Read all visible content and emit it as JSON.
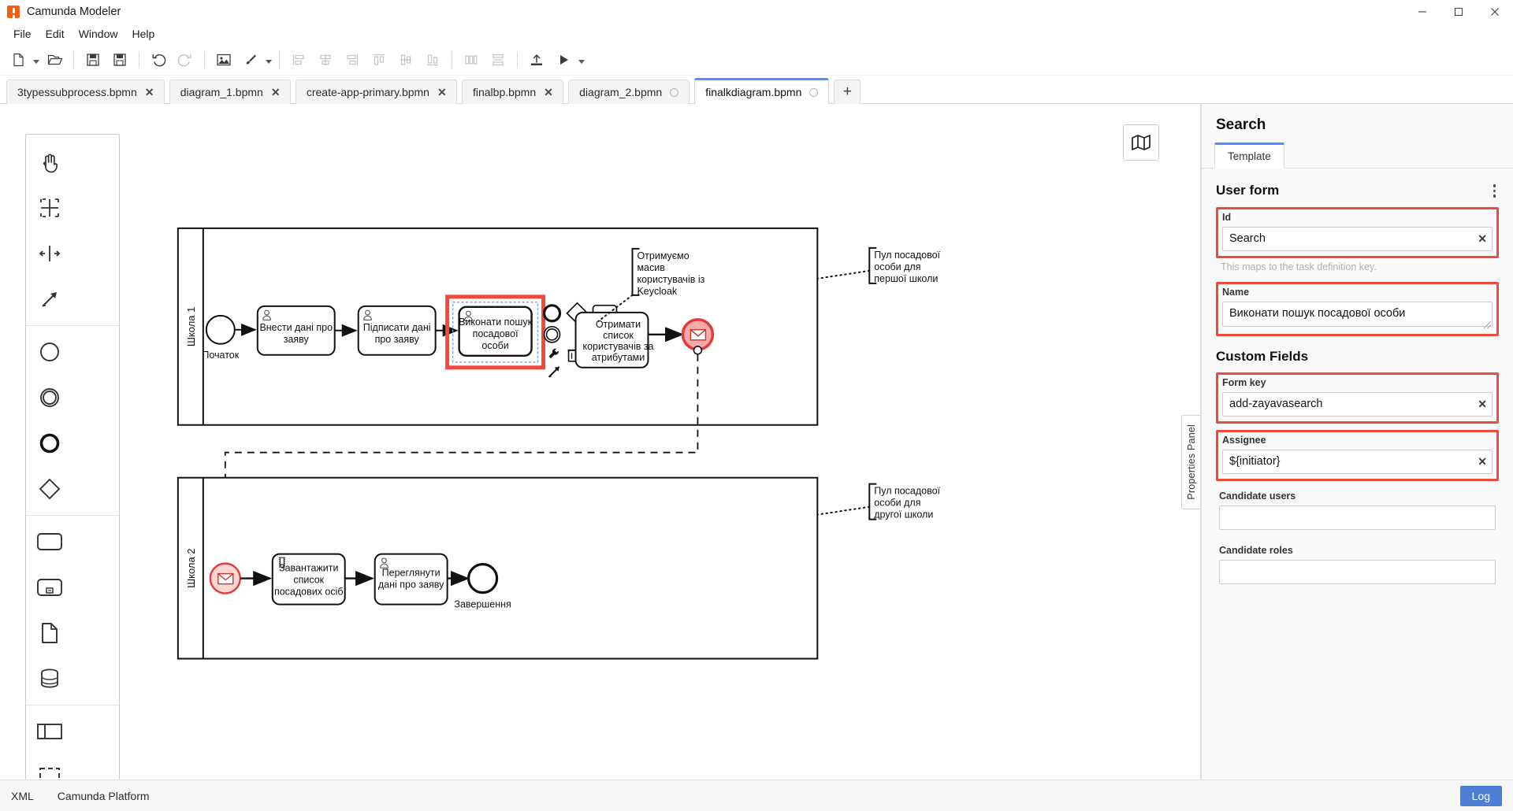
{
  "window": {
    "title": "Camunda Modeler",
    "app_icon": "camunda-icon",
    "minimize": "─",
    "maximize": "❐",
    "close": "✕"
  },
  "menubar": {
    "items": [
      {
        "label": "File"
      },
      {
        "label": "Edit"
      },
      {
        "label": "Window"
      },
      {
        "label": "Help"
      }
    ]
  },
  "toolbar": {
    "buttons": [
      {
        "name": "new-file-button",
        "icon": "new-file-icon"
      },
      {
        "name": "new-file-dropdown",
        "icon": "caret-down-icon"
      },
      {
        "name": "open-file-button",
        "icon": "open-folder-icon"
      },
      {
        "name": "save-button",
        "icon": "save-icon"
      },
      {
        "name": "save-as-button",
        "icon": "save-as-icon"
      },
      {
        "name": "undo-button",
        "icon": "undo-icon"
      },
      {
        "name": "redo-button",
        "icon": "redo-icon"
      },
      {
        "name": "export-image-button",
        "icon": "image-icon"
      },
      {
        "name": "align-tool-button",
        "icon": "brush-icon"
      },
      {
        "name": "align-tool-dropdown",
        "icon": "caret-down-icon"
      },
      {
        "name": "align-left-button",
        "icon": "align-left-icon"
      },
      {
        "name": "align-center-button",
        "icon": "align-center-icon"
      },
      {
        "name": "align-right-button",
        "icon": "align-right-icon"
      },
      {
        "name": "align-top-button",
        "icon": "align-top-icon"
      },
      {
        "name": "align-middle-button",
        "icon": "align-middle-icon"
      },
      {
        "name": "align-bottom-button",
        "icon": "align-bottom-icon"
      },
      {
        "name": "distribute-horizontal-button",
        "icon": "distribute-horizontal-icon"
      },
      {
        "name": "distribute-vertical-button",
        "icon": "distribute-vertical-icon"
      },
      {
        "name": "deploy-button",
        "icon": "deploy-upload-icon"
      },
      {
        "name": "start-instance-button",
        "icon": "play-icon"
      },
      {
        "name": "start-instance-dropdown",
        "icon": "caret-down-icon"
      }
    ]
  },
  "tabs": {
    "items": [
      {
        "label": "3typessubprocess.bpmn",
        "indicator": "close",
        "active": false
      },
      {
        "label": "diagram_1.bpmn",
        "indicator": "close",
        "active": false
      },
      {
        "label": "create-app-primary.bpmn",
        "indicator": "close",
        "active": false
      },
      {
        "label": "finalbp.bpmn",
        "indicator": "close",
        "active": false
      },
      {
        "label": "diagram_2.bpmn",
        "indicator": "dot",
        "active": false
      },
      {
        "label": "finalkdiagram.bpmn",
        "indicator": "dot",
        "active": true
      }
    ],
    "close_glyph": "✕",
    "new_tab_label": "+"
  },
  "palette": {
    "tools": [
      {
        "name": "hand-tool",
        "icon": "hand-icon"
      },
      {
        "name": "lasso-tool",
        "icon": "lasso-icon"
      },
      {
        "name": "space-tool",
        "icon": "space-tool-icon"
      },
      {
        "name": "connect-tool",
        "icon": "connect-arrow-icon"
      },
      {
        "name": "start-event-tool",
        "icon": "start-event-icon"
      },
      {
        "name": "intermediate-event-tool",
        "icon": "intermediate-event-icon"
      },
      {
        "name": "end-event-tool",
        "icon": "end-event-icon"
      },
      {
        "name": "gateway-tool",
        "icon": "gateway-diamond-icon"
      },
      {
        "name": "task-tool",
        "icon": "task-rect-icon"
      },
      {
        "name": "subprocess-tool",
        "icon": "subprocess-icon"
      },
      {
        "name": "data-object-tool",
        "icon": "data-object-icon"
      },
      {
        "name": "data-store-tool",
        "icon": "data-store-icon"
      },
      {
        "name": "participant-tool",
        "icon": "participant-pool-icon"
      },
      {
        "name": "group-tool",
        "icon": "group-icon"
      }
    ]
  },
  "canvas": {
    "minimap_button": "minimap-icon",
    "properties_panel_handle": "Properties Panel",
    "lanes": [
      {
        "name": "Школа 1"
      },
      {
        "name": "Школа 2"
      }
    ],
    "annotations": [
      {
        "text_lines": [
          "Отримуємо",
          "масив",
          "користувачів із",
          "Keycloak"
        ]
      },
      {
        "text_lines": [
          "Пул посадової",
          "особи для",
          "першої школи"
        ]
      },
      {
        "text_lines": [
          "Пул посадової",
          "особи для",
          "другої школи"
        ]
      }
    ],
    "pool1": {
      "start_event_label": "Початок",
      "tasks": [
        {
          "label_lines": [
            "Внести дані про",
            "заяву"
          ],
          "type": "user-task"
        },
        {
          "label_lines": [
            "Підписати дані",
            "про заяву"
          ],
          "type": "user-task"
        },
        {
          "label_lines": [
            "Виконати пошук",
            "посадової",
            "особи"
          ],
          "type": "user-task",
          "selected": true
        },
        {
          "label_lines": [
            "Отримати",
            "список",
            "користувачів за",
            "атрибутами"
          ],
          "type": "service-task"
        }
      ],
      "end_event": "message-end-event"
    },
    "pool2": {
      "start_event": "message-start-event",
      "tasks": [
        {
          "label_lines": [
            "Завантажити",
            "список",
            "посадових осіб"
          ],
          "type": "script-task"
        },
        {
          "label_lines": [
            "Переглянути",
            "дані про заяву"
          ],
          "type": "user-task"
        }
      ],
      "end_event_label": "Завершення"
    },
    "context_pad": [
      {
        "name": "append-end-event",
        "icon": "end-event-icon"
      },
      {
        "name": "append-intermediate-event",
        "icon": "intermediate-event-icon"
      },
      {
        "name": "append-gateway",
        "icon": "gateway-diamond-icon"
      },
      {
        "name": "append-task",
        "icon": "task-rect-icon"
      },
      {
        "name": "change-type",
        "icon": "wrench-icon"
      },
      {
        "name": "delete-element",
        "icon": "trash-icon"
      },
      {
        "name": "connect",
        "icon": "connect-arrow-icon"
      }
    ]
  },
  "properties": {
    "title": "Search",
    "tab_label": "Template",
    "group_title": "User form",
    "menu_icon": "kebab-menu-icon",
    "fields": {
      "id": {
        "label": "Id",
        "value": "Search",
        "hint": "This maps to the task definition key.",
        "clear": "✕",
        "highlighted": true
      },
      "name": {
        "label": "Name",
        "value": "Виконати пошук посадової особи",
        "highlighted": true
      },
      "custom_fields_title": "Custom Fields",
      "form_key": {
        "label": "Form key",
        "value": "add-zayavasearch",
        "clear": "✕",
        "highlighted": true
      },
      "assignee": {
        "label": "Assignee",
        "value": "${initiator}",
        "clear": "✕",
        "highlighted": true
      },
      "candidate_users": {
        "label": "Candidate users",
        "value": "",
        "placeholder": ""
      },
      "candidate_roles": {
        "label": "Candidate roles",
        "value": "",
        "placeholder": ""
      }
    },
    "accent_color": "#4d90fe",
    "highlight_color": "#f0493e"
  },
  "statusbar": {
    "items": [
      {
        "label": "XML"
      },
      {
        "label": "Camunda Platform"
      }
    ],
    "log_button": "Log"
  }
}
